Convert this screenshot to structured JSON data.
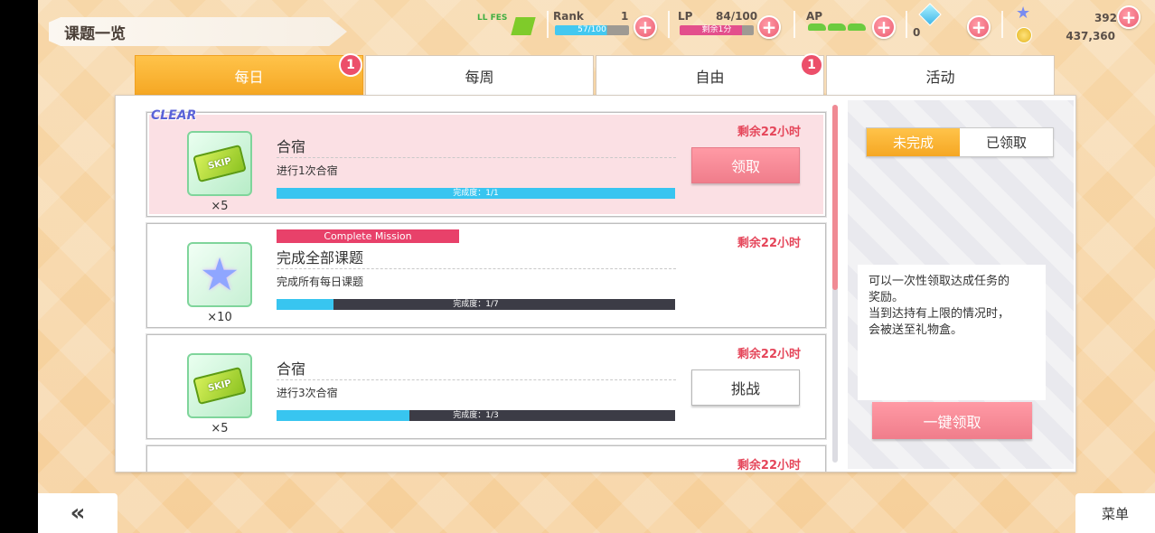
{
  "header": {
    "title": "课题一览"
  },
  "status": {
    "rank_label": "Rank",
    "rank_value": "1",
    "rank_exp": "57/100",
    "lp_label": "LP",
    "lp_value": "84/100",
    "lp_timer": "剩余1分",
    "ap_label": "AP",
    "gems": "0",
    "stars": "392",
    "coins": "437,360"
  },
  "tabs": [
    {
      "label": "每日",
      "badge": "1"
    },
    {
      "label": "每周",
      "badge": ""
    },
    {
      "label": "自由",
      "badge": "1"
    },
    {
      "label": "活动",
      "badge": ""
    }
  ],
  "missions": [
    {
      "clear_tag": "CLEAR",
      "title": "合宿",
      "desc": "进行1次合宿",
      "progress_text": "完成度：1/1",
      "progress": 1.0,
      "remain": "剩余22小时",
      "reward_qty": "×5",
      "reward_icon": "skip-ticket-icon",
      "reward_text": "SKIP",
      "action": "领取"
    },
    {
      "tag": "Complete Mission",
      "title": "完成全部课题",
      "desc": "完成所有每日课题",
      "progress_text": "完成度：1/7",
      "progress": 0.142857,
      "remain": "剩余22小时",
      "reward_qty": "×10",
      "reward_icon": "star-icon"
    },
    {
      "title": "合宿",
      "desc": "进行3次合宿",
      "progress_text": "完成度：1/3",
      "progress": 0.3333,
      "remain": "剩余22小时",
      "reward_qty": "×5",
      "reward_icon": "skip-ticket-icon",
      "reward_text": "SKIP",
      "action": "挑战"
    },
    {
      "remain": "剩余22小时"
    }
  ],
  "side": {
    "seg_incomplete": "未完成",
    "seg_received": "已领取",
    "note_lines": [
      "可以一次性领取达成任务的",
      "奖励。",
      "当到达持有上限的情况时，",
      "会被送至礼物盒。"
    ],
    "claim_all": "一键领取"
  },
  "footer": {
    "back": "«",
    "menu": "菜单"
  },
  "colors": {
    "accent": "#f5a723",
    "pink": "#f07d8b",
    "progress": "#38c5f0"
  }
}
